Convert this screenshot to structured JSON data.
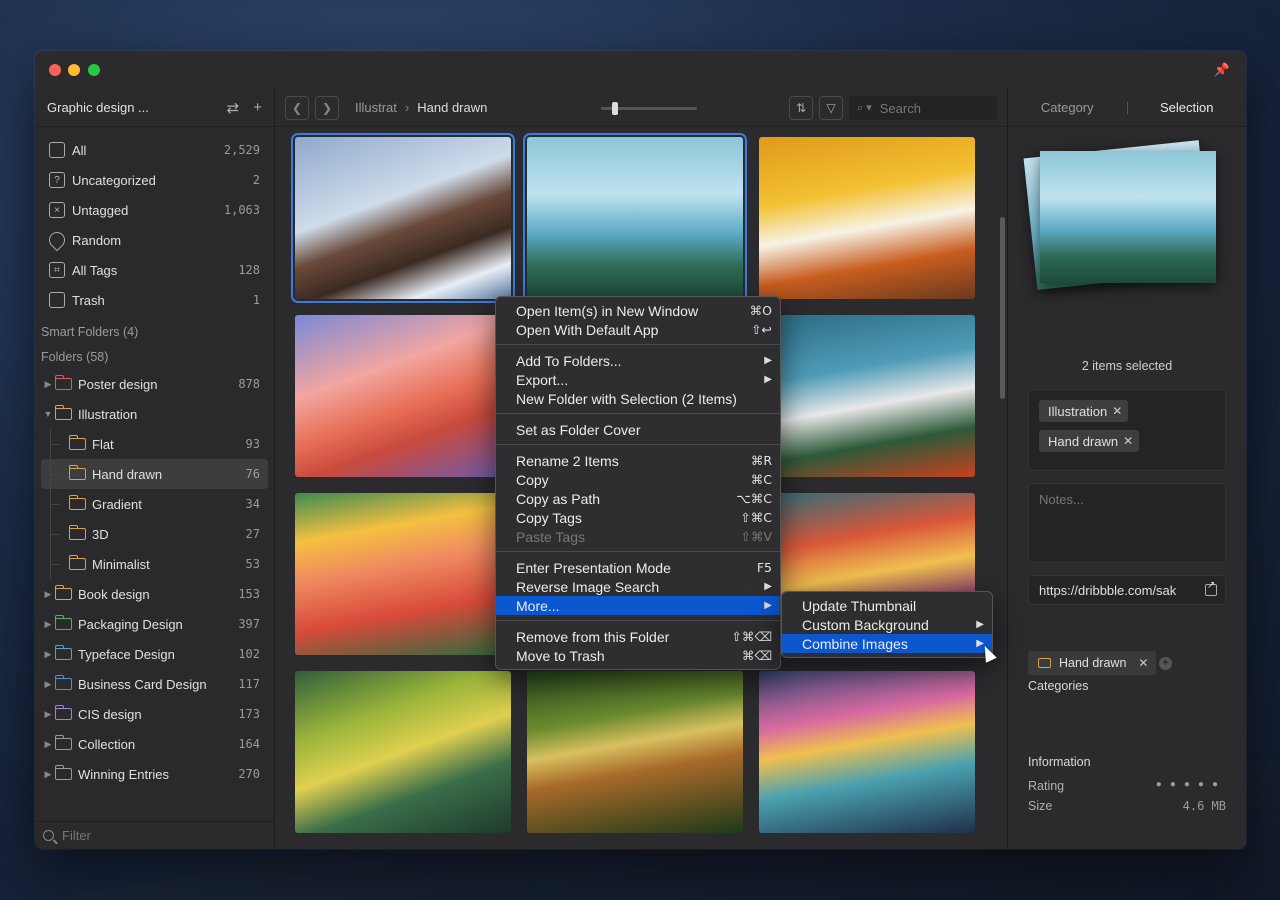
{
  "window": {
    "traffic_lights": [
      "close",
      "minimize",
      "zoom"
    ]
  },
  "sidebar": {
    "library_title": "Graphic design ...",
    "nav": [
      {
        "label": "All",
        "count": "2,529",
        "icon": "inbox-icon"
      },
      {
        "label": "Uncategorized",
        "count": "2",
        "icon": "question-icon"
      },
      {
        "label": "Untagged",
        "count": "1,063",
        "icon": "untagged-icon"
      },
      {
        "label": "Random",
        "count": "",
        "icon": "random-icon"
      },
      {
        "label": "All Tags",
        "count": "128",
        "icon": "tag-icon"
      },
      {
        "label": "Trash",
        "count": "1",
        "icon": "trash-icon"
      }
    ],
    "smart_folders_label": "Smart Folders (4)",
    "folders_label": "Folders (58)",
    "folders": [
      {
        "label": "Poster design",
        "count": "878",
        "color": "#e0595c",
        "expanded": false,
        "level": 0
      },
      {
        "label": "Illustration",
        "count": "",
        "color": "#d9a441",
        "expanded": true,
        "level": 0
      },
      {
        "label": "Flat",
        "count": "93",
        "color": "#d9a441",
        "level": 1
      },
      {
        "label": "Hand drawn",
        "count": "76",
        "color": "#d9a441",
        "level": 1,
        "active": true
      },
      {
        "label": "Gradient",
        "count": "34",
        "color": "#d9a441",
        "level": 1
      },
      {
        "label": "3D",
        "count": "27",
        "color": "#d9a441",
        "level": 1
      },
      {
        "label": "Minimalist",
        "count": "53",
        "color": "#d9a441",
        "level": 1
      },
      {
        "label": "Book design",
        "count": "153",
        "color": "#d9a441",
        "expanded": false,
        "level": 0
      },
      {
        "label": "Packaging Design",
        "count": "397",
        "color": "#4fb26b",
        "expanded": false,
        "level": 0
      },
      {
        "label": "Typeface Design",
        "count": "102",
        "color": "#3fb1c4",
        "expanded": false,
        "level": 0
      },
      {
        "label": "Business Card Design",
        "count": "117",
        "color": "#4a8fe0",
        "expanded": false,
        "level": 0
      },
      {
        "label": "CIS design",
        "count": "173",
        "color": "#a87de0",
        "expanded": false,
        "level": 0
      },
      {
        "label": "Collection",
        "count": "164",
        "color": "#9a9a9a",
        "expanded": false,
        "level": 0
      },
      {
        "label": "Winning Entries",
        "count": "270",
        "color": "#9a9a9a",
        "expanded": false,
        "level": 0
      }
    ],
    "filter_placeholder": "Filter"
  },
  "toolbar": {
    "breadcrumb_parent": "Illustrat",
    "breadcrumb_current": "Hand drawn",
    "search_placeholder": "Search"
  },
  "context_menu": {
    "groups": [
      [
        {
          "label": "Open Item(s) in New Window",
          "shortcut": "⌘O"
        },
        {
          "label": "Open With Default App",
          "shortcut": "⇧↩"
        }
      ],
      [
        {
          "label": "Add To Folders...",
          "submenu": true
        },
        {
          "label": "Export...",
          "submenu": true
        },
        {
          "label": "New Folder with Selection (2 Items)"
        }
      ],
      [
        {
          "label": "Set as Folder Cover"
        }
      ],
      [
        {
          "label": "Rename 2 Items",
          "shortcut": "⌘R"
        },
        {
          "label": "Copy",
          "shortcut": "⌘C"
        },
        {
          "label": "Copy as Path",
          "shortcut": "⌥⌘C"
        },
        {
          "label": "Copy Tags",
          "shortcut": "⇧⌘C"
        },
        {
          "label": "Paste Tags",
          "shortcut": "⇧⌘V",
          "disabled": true
        }
      ],
      [
        {
          "label": "Enter Presentation Mode",
          "shortcut": "F5"
        },
        {
          "label": "Reverse Image Search",
          "submenu": true
        },
        {
          "label": "More...",
          "submenu": true,
          "highlighted": true
        }
      ],
      [
        {
          "label": "Remove from this Folder",
          "shortcut": "⇧⌘⌫"
        },
        {
          "label": "Move to Trash",
          "shortcut": "⌘⌫"
        }
      ]
    ]
  },
  "submenu": [
    {
      "label": "Update Thumbnail"
    },
    {
      "label": "Custom Background",
      "submenu": true
    },
    {
      "label": "Combine Images",
      "submenu": true,
      "highlighted": true
    }
  ],
  "panel": {
    "tabs": [
      "Category",
      "Selection"
    ],
    "active_tab": "Selection",
    "selection_count": "2 items selected",
    "tags": [
      "Illustration",
      "Hand drawn"
    ],
    "notes_placeholder": "Notes...",
    "url": "https://dribbble.com/sak",
    "categories_label": "Categories",
    "categories": [
      "Hand drawn"
    ],
    "information_label": "Information",
    "rating_label": "Rating",
    "rating_value": 0,
    "size_label": "Size",
    "size_value": "4.6 MB"
  },
  "thumbnails": [
    {
      "id": "t1",
      "selected": true,
      "colors": [
        "#8fa9cc",
        "#6a4a3a"
      ]
    },
    {
      "id": "t2",
      "selected": true,
      "colors": [
        "#8cc6d8",
        "#2e6a55"
      ]
    },
    {
      "id": "t3",
      "selected": false,
      "colors": [
        "#e09a1a",
        "#f7f2e6"
      ]
    },
    {
      "id": "t4",
      "selected": false,
      "colors": [
        "#f2a6a0",
        "#c94a3d"
      ]
    },
    {
      "id": "t5",
      "selected": false,
      "colors": [
        "#2b6a82",
        "#e8e8e8"
      ]
    },
    {
      "id": "t6",
      "selected": false,
      "colors": [
        "#3e8a52",
        "#f08a60"
      ]
    },
    {
      "id": "t7",
      "selected": false,
      "colors": [
        "#2d6e7a",
        "#f0c050"
      ]
    },
    {
      "id": "t8",
      "selected": false,
      "colors": [
        "#2f5e3a",
        "#9bb53a"
      ]
    },
    {
      "id": "t9",
      "selected": false,
      "colors": [
        "#2b4a1e",
        "#d8c060"
      ]
    },
    {
      "id": "t10",
      "selected": false,
      "colors": [
        "#3a4a7a",
        "#d86aa0"
      ]
    }
  ]
}
